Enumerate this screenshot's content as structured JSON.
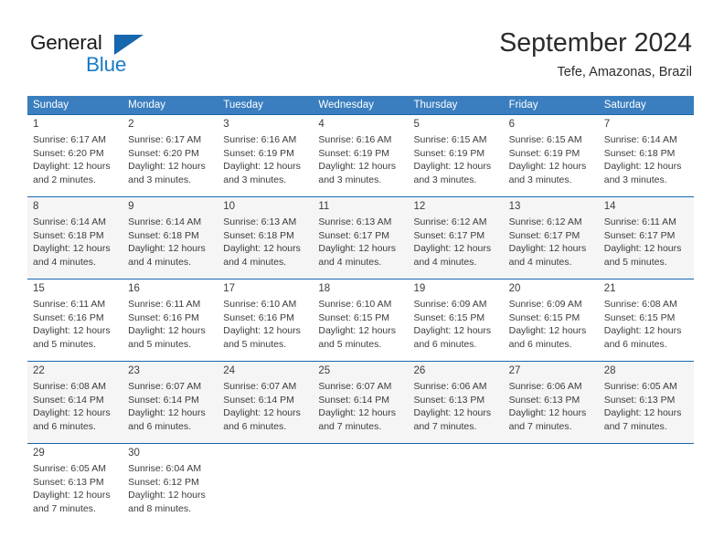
{
  "brand": {
    "name_part1": "General",
    "name_part2": "Blue",
    "flag_icon": "triangle-flag-icon",
    "accent_color": "#1a7cc4",
    "flag_color": "#1667ad"
  },
  "header": {
    "title": "September 2024",
    "subtitle": "Tefe, Amazonas, Brazil"
  },
  "calendar": {
    "header_bg_color": "#3a7ebf",
    "row_divider_color": "#1667ad",
    "alt_row_bg_color": "#f5f5f5",
    "day_names": [
      "Sunday",
      "Monday",
      "Tuesday",
      "Wednesday",
      "Thursday",
      "Friday",
      "Saturday"
    ],
    "weeks": [
      {
        "shaded": false,
        "days": [
          {
            "num": "1",
            "sunrise": "Sunrise: 6:17 AM",
            "sunset": "Sunset: 6:20 PM",
            "daylight1": "Daylight: 12 hours",
            "daylight2": "and 2 minutes."
          },
          {
            "num": "2",
            "sunrise": "Sunrise: 6:17 AM",
            "sunset": "Sunset: 6:20 PM",
            "daylight1": "Daylight: 12 hours",
            "daylight2": "and 3 minutes."
          },
          {
            "num": "3",
            "sunrise": "Sunrise: 6:16 AM",
            "sunset": "Sunset: 6:19 PM",
            "daylight1": "Daylight: 12 hours",
            "daylight2": "and 3 minutes."
          },
          {
            "num": "4",
            "sunrise": "Sunrise: 6:16 AM",
            "sunset": "Sunset: 6:19 PM",
            "daylight1": "Daylight: 12 hours",
            "daylight2": "and 3 minutes."
          },
          {
            "num": "5",
            "sunrise": "Sunrise: 6:15 AM",
            "sunset": "Sunset: 6:19 PM",
            "daylight1": "Daylight: 12 hours",
            "daylight2": "and 3 minutes."
          },
          {
            "num": "6",
            "sunrise": "Sunrise: 6:15 AM",
            "sunset": "Sunset: 6:19 PM",
            "daylight1": "Daylight: 12 hours",
            "daylight2": "and 3 minutes."
          },
          {
            "num": "7",
            "sunrise": "Sunrise: 6:14 AM",
            "sunset": "Sunset: 6:18 PM",
            "daylight1": "Daylight: 12 hours",
            "daylight2": "and 3 minutes."
          }
        ]
      },
      {
        "shaded": true,
        "days": [
          {
            "num": "8",
            "sunrise": "Sunrise: 6:14 AM",
            "sunset": "Sunset: 6:18 PM",
            "daylight1": "Daylight: 12 hours",
            "daylight2": "and 4 minutes."
          },
          {
            "num": "9",
            "sunrise": "Sunrise: 6:14 AM",
            "sunset": "Sunset: 6:18 PM",
            "daylight1": "Daylight: 12 hours",
            "daylight2": "and 4 minutes."
          },
          {
            "num": "10",
            "sunrise": "Sunrise: 6:13 AM",
            "sunset": "Sunset: 6:18 PM",
            "daylight1": "Daylight: 12 hours",
            "daylight2": "and 4 minutes."
          },
          {
            "num": "11",
            "sunrise": "Sunrise: 6:13 AM",
            "sunset": "Sunset: 6:17 PM",
            "daylight1": "Daylight: 12 hours",
            "daylight2": "and 4 minutes."
          },
          {
            "num": "12",
            "sunrise": "Sunrise: 6:12 AM",
            "sunset": "Sunset: 6:17 PM",
            "daylight1": "Daylight: 12 hours",
            "daylight2": "and 4 minutes."
          },
          {
            "num": "13",
            "sunrise": "Sunrise: 6:12 AM",
            "sunset": "Sunset: 6:17 PM",
            "daylight1": "Daylight: 12 hours",
            "daylight2": "and 4 minutes."
          },
          {
            "num": "14",
            "sunrise": "Sunrise: 6:11 AM",
            "sunset": "Sunset: 6:17 PM",
            "daylight1": "Daylight: 12 hours",
            "daylight2": "and 5 minutes."
          }
        ]
      },
      {
        "shaded": false,
        "days": [
          {
            "num": "15",
            "sunrise": "Sunrise: 6:11 AM",
            "sunset": "Sunset: 6:16 PM",
            "daylight1": "Daylight: 12 hours",
            "daylight2": "and 5 minutes."
          },
          {
            "num": "16",
            "sunrise": "Sunrise: 6:11 AM",
            "sunset": "Sunset: 6:16 PM",
            "daylight1": "Daylight: 12 hours",
            "daylight2": "and 5 minutes."
          },
          {
            "num": "17",
            "sunrise": "Sunrise: 6:10 AM",
            "sunset": "Sunset: 6:16 PM",
            "daylight1": "Daylight: 12 hours",
            "daylight2": "and 5 minutes."
          },
          {
            "num": "18",
            "sunrise": "Sunrise: 6:10 AM",
            "sunset": "Sunset: 6:15 PM",
            "daylight1": "Daylight: 12 hours",
            "daylight2": "and 5 minutes."
          },
          {
            "num": "19",
            "sunrise": "Sunrise: 6:09 AM",
            "sunset": "Sunset: 6:15 PM",
            "daylight1": "Daylight: 12 hours",
            "daylight2": "and 6 minutes."
          },
          {
            "num": "20",
            "sunrise": "Sunrise: 6:09 AM",
            "sunset": "Sunset: 6:15 PM",
            "daylight1": "Daylight: 12 hours",
            "daylight2": "and 6 minutes."
          },
          {
            "num": "21",
            "sunrise": "Sunrise: 6:08 AM",
            "sunset": "Sunset: 6:15 PM",
            "daylight1": "Daylight: 12 hours",
            "daylight2": "and 6 minutes."
          }
        ]
      },
      {
        "shaded": true,
        "days": [
          {
            "num": "22",
            "sunrise": "Sunrise: 6:08 AM",
            "sunset": "Sunset: 6:14 PM",
            "daylight1": "Daylight: 12 hours",
            "daylight2": "and 6 minutes."
          },
          {
            "num": "23",
            "sunrise": "Sunrise: 6:07 AM",
            "sunset": "Sunset: 6:14 PM",
            "daylight1": "Daylight: 12 hours",
            "daylight2": "and 6 minutes."
          },
          {
            "num": "24",
            "sunrise": "Sunrise: 6:07 AM",
            "sunset": "Sunset: 6:14 PM",
            "daylight1": "Daylight: 12 hours",
            "daylight2": "and 6 minutes."
          },
          {
            "num": "25",
            "sunrise": "Sunrise: 6:07 AM",
            "sunset": "Sunset: 6:14 PM",
            "daylight1": "Daylight: 12 hours",
            "daylight2": "and 7 minutes."
          },
          {
            "num": "26",
            "sunrise": "Sunrise: 6:06 AM",
            "sunset": "Sunset: 6:13 PM",
            "daylight1": "Daylight: 12 hours",
            "daylight2": "and 7 minutes."
          },
          {
            "num": "27",
            "sunrise": "Sunrise: 6:06 AM",
            "sunset": "Sunset: 6:13 PM",
            "daylight1": "Daylight: 12 hours",
            "daylight2": "and 7 minutes."
          },
          {
            "num": "28",
            "sunrise": "Sunrise: 6:05 AM",
            "sunset": "Sunset: 6:13 PM",
            "daylight1": "Daylight: 12 hours",
            "daylight2": "and 7 minutes."
          }
        ]
      },
      {
        "shaded": false,
        "days": [
          {
            "num": "29",
            "sunrise": "Sunrise: 6:05 AM",
            "sunset": "Sunset: 6:13 PM",
            "daylight1": "Daylight: 12 hours",
            "daylight2": "and 7 minutes."
          },
          {
            "num": "30",
            "sunrise": "Sunrise: 6:04 AM",
            "sunset": "Sunset: 6:12 PM",
            "daylight1": "Daylight: 12 hours",
            "daylight2": "and 8 minutes."
          },
          {
            "num": "",
            "sunrise": "",
            "sunset": "",
            "daylight1": "",
            "daylight2": ""
          },
          {
            "num": "",
            "sunrise": "",
            "sunset": "",
            "daylight1": "",
            "daylight2": ""
          },
          {
            "num": "",
            "sunrise": "",
            "sunset": "",
            "daylight1": "",
            "daylight2": ""
          },
          {
            "num": "",
            "sunrise": "",
            "sunset": "",
            "daylight1": "",
            "daylight2": ""
          },
          {
            "num": "",
            "sunrise": "",
            "sunset": "",
            "daylight1": "",
            "daylight2": ""
          }
        ]
      }
    ]
  }
}
